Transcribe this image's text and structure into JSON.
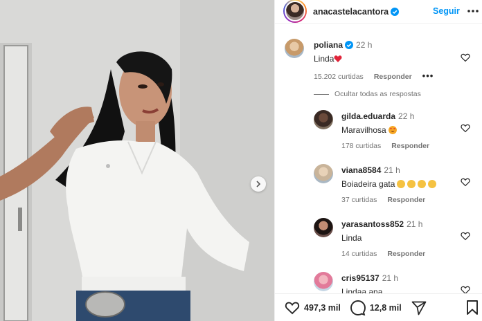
{
  "post": {
    "author": "anacastelacantora",
    "follow_label": "Seguir"
  },
  "comments": [
    {
      "user": "poliana",
      "verified": true,
      "time": "22 h",
      "text": "Linda",
      "likes": "15.202 curtidas",
      "reply_label": "Responder",
      "emoji": "heart"
    },
    {
      "user": "gilda.eduarda",
      "time": "22 h",
      "text": "Maravilhosa",
      "likes": "178 curtidas",
      "reply_label": "Responder",
      "emoji": "heart-eyes"
    },
    {
      "user": "viana8584",
      "time": "21 h",
      "text": "Boiadeira gata",
      "likes": "37 curtidas",
      "reply_label": "Responder",
      "emoji": "clap x4"
    },
    {
      "user": "yarasantoss852",
      "time": "21 h",
      "text": "Linda",
      "likes": "14 curtidas",
      "reply_label": "Responder"
    },
    {
      "user": "cris95137",
      "time": "21 h",
      "text": "Lindaa ana"
    }
  ],
  "hide_replies_label": "Ocultar todas as respostas",
  "actions": {
    "likes": "497,3 mil",
    "comments": "12,8 mil"
  },
  "icons": {
    "verified": "verified-badge-icon",
    "more": "more-horizontal-icon",
    "like": "heart-outline-icon",
    "comment": "comment-bubble-icon",
    "share": "paper-plane-icon",
    "save": "bookmark-icon",
    "next": "chevron-right-icon"
  },
  "colors": {
    "accent": "#0095f6",
    "text": "#262626",
    "muted": "#737373",
    "heart": "#ed4956"
  }
}
